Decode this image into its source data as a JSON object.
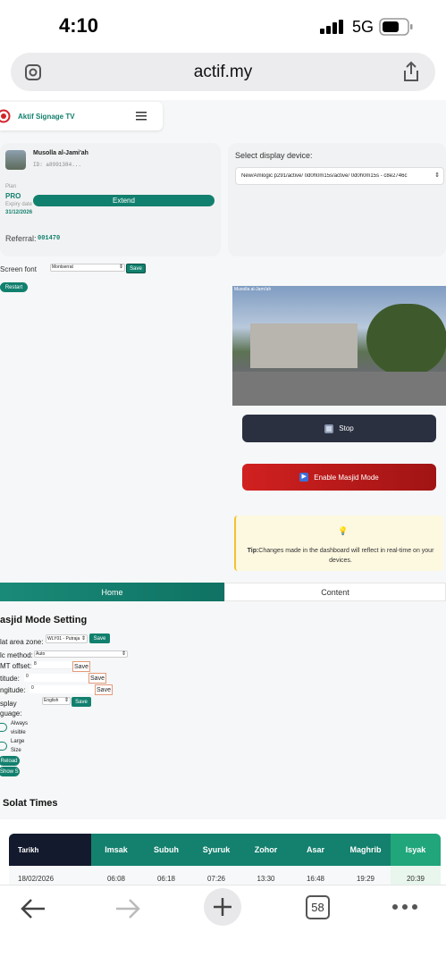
{
  "status": {
    "time": "4:10",
    "network": "5G"
  },
  "browser": {
    "url": "actif.my",
    "tab_count": "58"
  },
  "brand": {
    "title": "Aktif Signage TV"
  },
  "profile": {
    "name": "Musolla al-Jami'ah",
    "id": "ID: a8991384...",
    "plan_label": "Plan",
    "plan_value": "PRO",
    "expiry_label": "Expiry date",
    "expiry_value": "31/12/2026",
    "extend": "Extend",
    "referral_label": "Referral:",
    "referral_value": "001470"
  },
  "device": {
    "label": "Select display device:",
    "selected": "New/Amlogic p291/active/ 0d0h0m15s/active/ 0d0h0m15s - c8e2746c"
  },
  "font_setting": {
    "label": "Screen font",
    "selected": "Montserrat",
    "save": "Save",
    "restart": "Restart"
  },
  "preview": {
    "caption": "Musolla al-Jami'ah"
  },
  "controls": {
    "stop": "Stop",
    "masjid": "Enable Masjid Mode"
  },
  "tip": {
    "label": "Tip:",
    "text": "Changes made in the dashboard will reflect in real-time on your devices."
  },
  "tabs": {
    "home": "Home",
    "content": "Content"
  },
  "masjid": {
    "title": "asjid Mode Setting",
    "zone_label": "lat area zone:",
    "zone_value": "WLY01 - Putraja",
    "save": "Save",
    "calc_label": "lc method:",
    "calc_value": "Auto",
    "gmt_label": "MT offset:",
    "gmt_value": "8",
    "lat_label": "titude:",
    "lat_value": "0",
    "lng_label": "ngitude:",
    "lng_value": "0",
    "lang_label": "splay",
    "lang_label2": "guage:",
    "lang_value": "English",
    "always": "Always visible",
    "always1": "Always",
    "always2": "visible",
    "large1": "Large",
    "large2": "Size",
    "reload": "Reload",
    "show": "Show S"
  },
  "solat": {
    "title": "Solat Times",
    "headers": [
      "Tarikh",
      "Imsak",
      "Subuh",
      "Syuruk",
      "Zohor",
      "Asar",
      "Maghrib",
      "Isyak"
    ],
    "row": [
      "18/02/2026",
      "06:08",
      "06:18",
      "07:26",
      "13:30",
      "16:48",
      "19:29",
      "20:39"
    ]
  },
  "colors": {
    "teal": "#12806e",
    "dark": "#2a3040",
    "red": "#c81e1e",
    "navy": "#141a2e"
  }
}
